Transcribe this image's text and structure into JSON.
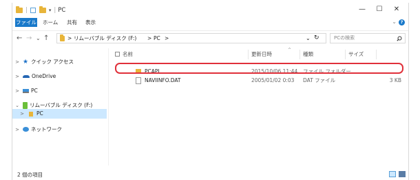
{
  "window": {
    "title": "PC",
    "controls": {
      "minimize": "—",
      "maximize": "☐",
      "close": "✕"
    }
  },
  "ribbon": {
    "tabs": [
      "ファイル",
      "ホーム",
      "共有",
      "表示"
    ],
    "colors": {
      "file_tab": "#1979ca",
      "help": "#1979ca"
    }
  },
  "addressbar": {
    "nav": {
      "back": "←",
      "forward": "→",
      "recent": "⌄",
      "up": "↑"
    },
    "path": [
      "リムーバブル ディスク (F:)",
      "PC"
    ],
    "path_separator": ">",
    "dropdown": "⌄",
    "refresh": "↻",
    "search_placeholder": "PCの検索",
    "search_icon": "search-icon"
  },
  "navpane": {
    "items": [
      {
        "label": "クイック アクセス",
        "icon": "star-icon",
        "expander": ">",
        "selected": false
      },
      {
        "label": "OneDrive",
        "icon": "cloud-icon",
        "expander": ">",
        "selected": false
      },
      {
        "label": "PC",
        "icon": "computer-icon",
        "expander": ">",
        "selected": false
      },
      {
        "label": "リムーバブル ディスク (F:)",
        "icon": "usb-drive-icon",
        "expander": "⌄",
        "selected": false
      },
      {
        "label": "PC",
        "icon": "folder-icon",
        "expander": ">",
        "selected": true
      },
      {
        "label": "ネットワーク",
        "icon": "network-icon",
        "expander": ">",
        "selected": false
      }
    ]
  },
  "filelist": {
    "columns": {
      "name": "名前",
      "modified": "更新日時",
      "type": "種類",
      "size": "サイズ",
      "sort_indicator": "^"
    },
    "rows": [
      {
        "name": "PCAPL",
        "modified": "2015/10/06 11:44",
        "type": "ファイル フォルダー",
        "size": "",
        "icon": "folder-icon"
      },
      {
        "name": "NAVIINFO.DAT",
        "modified": "2005/01/02 0:03",
        "type": "DAT ファイル",
        "size": "3 KB",
        "icon": "file-icon"
      }
    ],
    "highlight_color": "#e0303a"
  },
  "statusbar": {
    "item_count": "2 個の項目"
  }
}
